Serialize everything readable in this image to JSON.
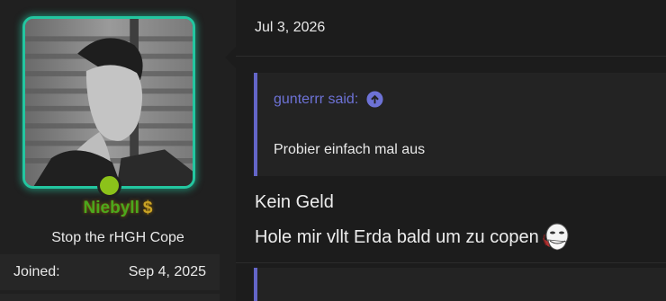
{
  "user": {
    "name": "Niebyll",
    "dollar_badge": "$",
    "title": "Stop the rHGH Cope",
    "joined_label": "Joined:",
    "joined_value": "Sep 4, 2025",
    "online_status_color": "#8cc21a",
    "avatar_frame_color": "#23c6a0"
  },
  "post": {
    "date": "Jul 3, 2026",
    "quote": {
      "author": "gunterrr said:",
      "text": "Probier einfach mal aus",
      "icon": "arrow-up-circle-icon",
      "accent_color": "#6466c8"
    },
    "message_line1": "Kein Geld",
    "message_line2": "Hole mir vllt Erda bald um zu copen",
    "emoji": "troll-face-emoji"
  }
}
